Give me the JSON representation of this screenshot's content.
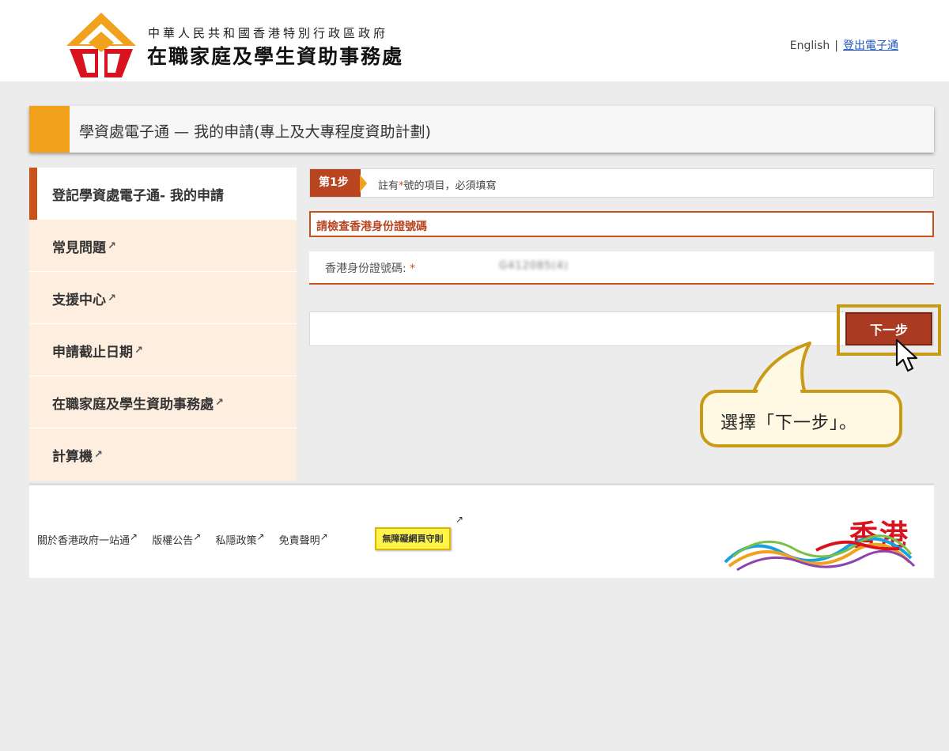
{
  "header": {
    "org_small": "中華人民共和國香港特別行政區政府",
    "org_big": "在職家庭及學生資助事務處",
    "lang_link": "English",
    "separator": "|",
    "logout_link": "登出電子通"
  },
  "page_title": "學資處電子通 — 我的申請(專上及大專程度資助計劃)",
  "sidebar": {
    "items": [
      {
        "label": "登記學資處電子通- 我的申請",
        "external": false
      },
      {
        "label": "常見問題",
        "external": true
      },
      {
        "label": "支援中心",
        "external": true
      },
      {
        "label": "申請截止日期",
        "external": true
      },
      {
        "label": "在職家庭及學生資助事務處",
        "external": true
      },
      {
        "label": "計算機",
        "external": true
      }
    ]
  },
  "step": {
    "badge": "第1步",
    "note_prefix": "註有",
    "note_star": "*",
    "note_suffix": "號的項目，必須填寫"
  },
  "section_title": "請檢查香港身份證號碼",
  "id_field": {
    "label": "香港身份證號碼:",
    "required_mark": "*",
    "value": "G412085(4)"
  },
  "next_button": "下一步",
  "callout": "選擇「下一步」。",
  "footer": {
    "links": [
      "關於香港政府一站通",
      "版權公告",
      "私隱政策",
      "免責聲明"
    ],
    "accessibility_badge": "無障礙網頁守則",
    "brand_text": "香港"
  },
  "icons": {
    "external": "↗",
    "cursor": "mouse-pointer-icon"
  },
  "colors": {
    "accent_orange": "#f2a11c",
    "brand_red": "#c9531a",
    "button_red": "#ab3a22",
    "highlight_gold": "#c99a14"
  }
}
